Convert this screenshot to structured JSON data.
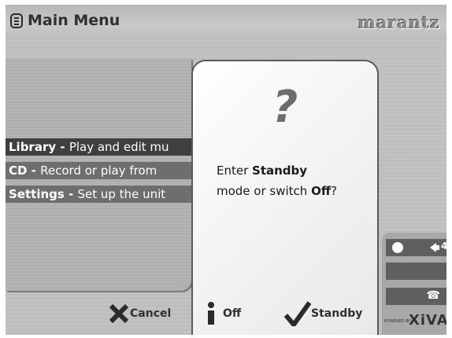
{
  "header": {
    "title": "Main Menu",
    "brand": "marantz"
  },
  "menu": {
    "items": [
      {
        "label": "Library - ",
        "desc": "Play and edit mu",
        "selected": true
      },
      {
        "label": "CD - ",
        "desc": "Record or play from",
        "selected": false
      },
      {
        "label": "Settings - ",
        "desc": "Set up the unit",
        "selected": false
      }
    ]
  },
  "dialog": {
    "symbol": "?",
    "line1_prefix": "Enter ",
    "line1_bold": "Standby",
    "line2_prefix": "mode or switch ",
    "line2_bold": "Off",
    "line2_suffix": "?"
  },
  "buttons": {
    "cancel": "Cancel",
    "off": "Off",
    "standby": "Standby"
  },
  "status": {
    "volume": "4",
    "powered_by": "POWERED BY",
    "platform": "XiVA"
  },
  "colors": {
    "check": "#2a2a2a",
    "panel": "#6e6e6e"
  }
}
